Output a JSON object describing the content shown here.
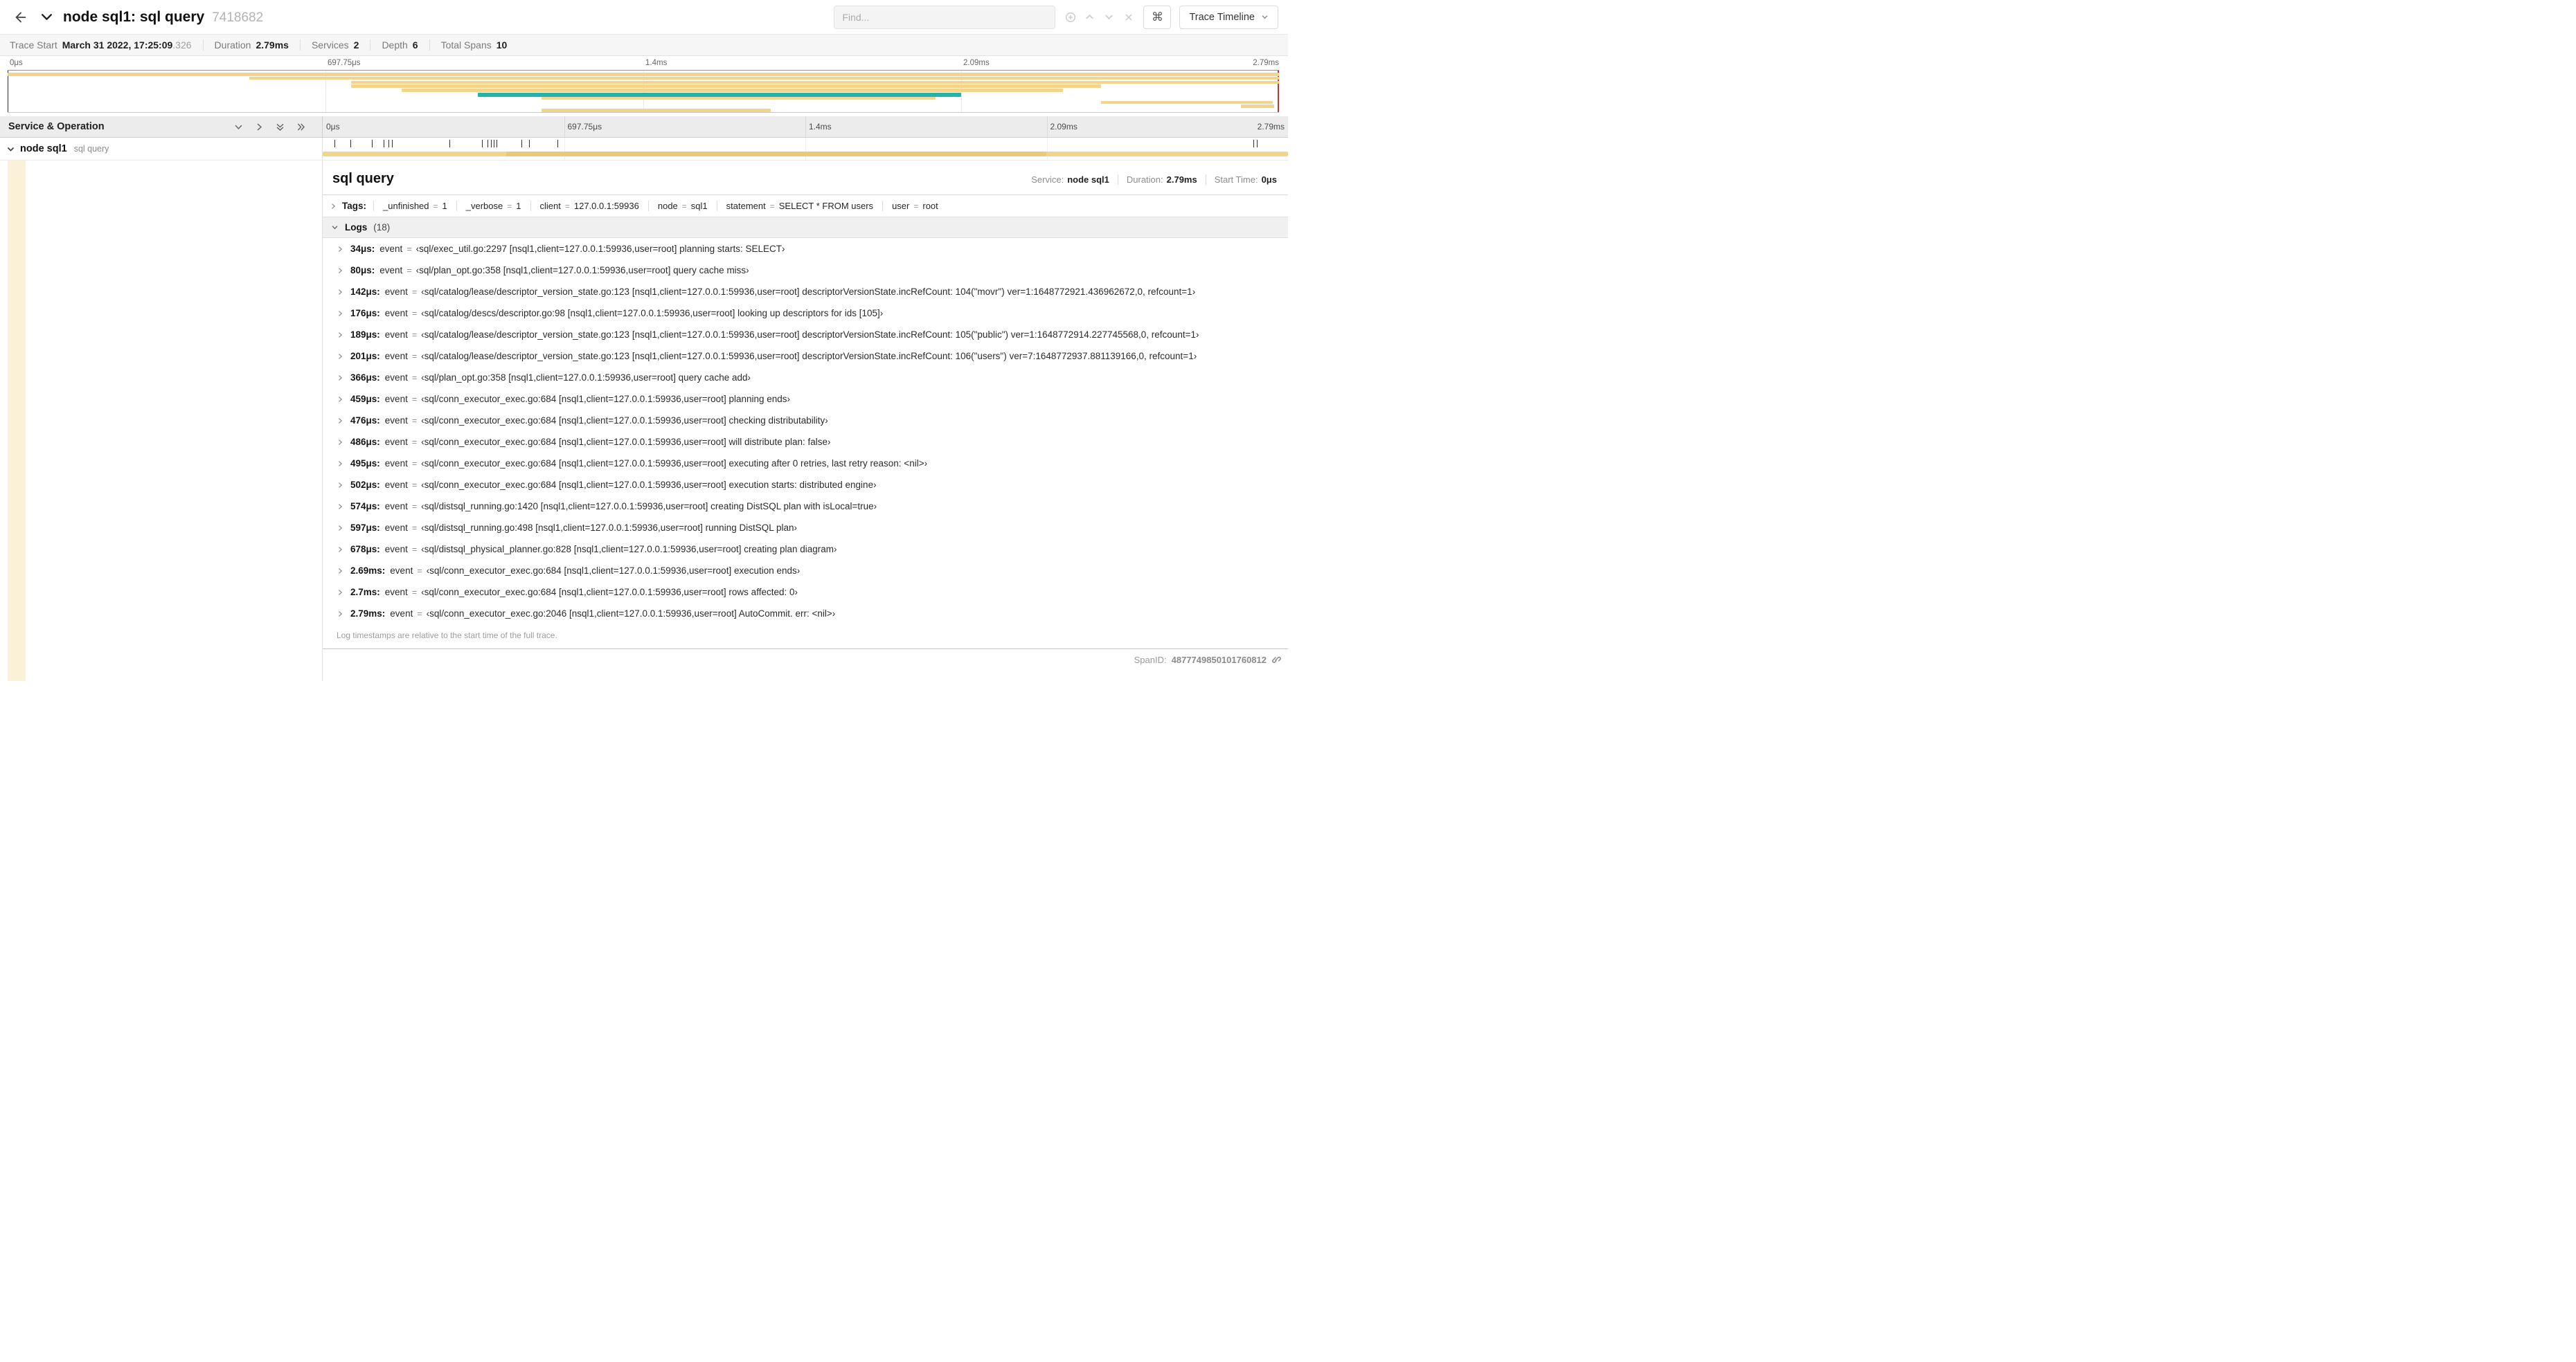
{
  "colors": {
    "span_tan": "#F2D48C",
    "span_tan_dark": "#ECC878",
    "span_teal": "#24B3AC",
    "row_stripe": "#FAF1D8"
  },
  "icons": {
    "back": "arrow-left",
    "collapse_trace": "chevron-down",
    "find_first": "plus-circle",
    "find_prev": "chevron-up",
    "find_next": "chevron-down",
    "find_clear": "x",
    "shortcuts": "⌘",
    "view_dropdown": "chevron-down",
    "collapse_one": "chevron-down",
    "expand_one": "chevron-right",
    "collapse_all": "double-chevron-down",
    "expand_all": "double-chevron-right",
    "link": "link"
  },
  "header": {
    "title": "node sql1: sql query",
    "trace_id": "7418682",
    "find_placeholder": "Find...",
    "view_label": "Trace Timeline"
  },
  "trace_info": {
    "items": [
      {
        "label": "Trace Start",
        "value": "March 31 2022, 17:25:09",
        "suffix": ".326"
      },
      {
        "label": "Duration",
        "value": "2.79ms"
      },
      {
        "label": "Services",
        "value": "2"
      },
      {
        "label": "Depth",
        "value": "6"
      },
      {
        "label": "Total Spans",
        "value": "10"
      }
    ]
  },
  "minimap": {
    "tick_labels": [
      "0μs",
      "697.75μs",
      "1.4ms",
      "2.09ms",
      "2.79ms"
    ],
    "spans": [
      {
        "row": 0,
        "start": 0,
        "width": 100,
        "color": "tan"
      },
      {
        "row": 1,
        "start": 19,
        "width": 81,
        "color": "tan"
      },
      {
        "row": 2,
        "start": 27,
        "width": 73,
        "color": "tan"
      },
      {
        "row": 3,
        "start": 27,
        "width": 59,
        "color": "tan"
      },
      {
        "row": 4,
        "start": 31,
        "width": 52,
        "color": "tan"
      },
      {
        "row": 5,
        "start": 37,
        "width": 38,
        "color": "teal"
      },
      {
        "row": 6,
        "start": 42,
        "width": 31,
        "color": "tan"
      },
      {
        "row": 7,
        "start": 86,
        "width": 13.5,
        "color": "tan"
      },
      {
        "row": 8,
        "start": 97,
        "width": 2.6,
        "color": "tan"
      },
      {
        "row": 9,
        "start": 42,
        "width": 18,
        "color": "tan"
      }
    ]
  },
  "timeline": {
    "left_title": "Service & Operation",
    "tick_labels": [
      "0μs",
      "697.75μs",
      "1.4ms",
      "2.09ms",
      "2.79ms"
    ]
  },
  "span_row": {
    "service": "node sql1",
    "operation": "sql query",
    "tick_pcts": [
      1.2,
      2.9,
      5.1,
      6.3,
      6.8,
      7.2,
      13.1,
      16.5,
      17.1,
      17.4,
      17.7,
      18,
      20.6,
      21.4,
      24.3,
      96.4,
      96.8
    ],
    "bar_dark_segments": [
      {
        "start": 19,
        "width": 56
      }
    ]
  },
  "detail": {
    "title": "sql query",
    "meta": [
      {
        "label": "Service:",
        "value": "node sql1"
      },
      {
        "label": "Duration:",
        "value": "2.79ms"
      },
      {
        "label": "Start Time:",
        "value": "0μs"
      }
    ],
    "tags_label": "Tags:",
    "tag_eq": "=",
    "tags": [
      {
        "key": "_unfinished",
        "value": "1"
      },
      {
        "key": "_verbose",
        "value": "1"
      },
      {
        "key": "client",
        "value": "127.0.0.1:59936"
      },
      {
        "key": "node",
        "value": "sql1"
      },
      {
        "key": "statement",
        "value": "SELECT * FROM users"
      },
      {
        "key": "user",
        "value": "root"
      }
    ],
    "logs_label": "Logs",
    "logs_count": "(18)",
    "log_event_key": "event",
    "log_eq": "=",
    "logs": [
      {
        "time": "34μs:",
        "msg": "‹sql/exec_util.go:2297 [nsql1,client=127.0.0.1:59936,user=root] planning starts: SELECT›"
      },
      {
        "time": "80μs:",
        "msg": "‹sql/plan_opt.go:358 [nsql1,client=127.0.0.1:59936,user=root] query cache miss›"
      },
      {
        "time": "142μs:",
        "msg": "‹sql/catalog/lease/descriptor_version_state.go:123 [nsql1,client=127.0.0.1:59936,user=root] descriptorVersionState.incRefCount: 104(\"movr\") ver=1:1648772921.436962672,0, refcount=1›"
      },
      {
        "time": "176μs:",
        "msg": "‹sql/catalog/descs/descriptor.go:98 [nsql1,client=127.0.0.1:59936,user=root] looking up descriptors for ids [105]›"
      },
      {
        "time": "189μs:",
        "msg": "‹sql/catalog/lease/descriptor_version_state.go:123 [nsql1,client=127.0.0.1:59936,user=root] descriptorVersionState.incRefCount: 105(\"public\") ver=1:1648772914.227745568,0, refcount=1›"
      },
      {
        "time": "201μs:",
        "msg": "‹sql/catalog/lease/descriptor_version_state.go:123 [nsql1,client=127.0.0.1:59936,user=root] descriptorVersionState.incRefCount: 106(\"users\") ver=7:1648772937.881139166,0, refcount=1›"
      },
      {
        "time": "366μs:",
        "msg": "‹sql/plan_opt.go:358 [nsql1,client=127.0.0.1:59936,user=root] query cache add›"
      },
      {
        "time": "459μs:",
        "msg": "‹sql/conn_executor_exec.go:684 [nsql1,client=127.0.0.1:59936,user=root] planning ends›"
      },
      {
        "time": "476μs:",
        "msg": "‹sql/conn_executor_exec.go:684 [nsql1,client=127.0.0.1:59936,user=root] checking distributability›"
      },
      {
        "time": "486μs:",
        "msg": "‹sql/conn_executor_exec.go:684 [nsql1,client=127.0.0.1:59936,user=root] will distribute plan: false›"
      },
      {
        "time": "495μs:",
        "msg": "‹sql/conn_executor_exec.go:684 [nsql1,client=127.0.0.1:59936,user=root] executing after 0 retries, last retry reason: <nil>›"
      },
      {
        "time": "502μs:",
        "msg": "‹sql/conn_executor_exec.go:684 [nsql1,client=127.0.0.1:59936,user=root] execution starts: distributed engine›"
      },
      {
        "time": "574μs:",
        "msg": "‹sql/distsql_running.go:1420 [nsql1,client=127.0.0.1:59936,user=root] creating DistSQL plan with isLocal=true›"
      },
      {
        "time": "597μs:",
        "msg": "‹sql/distsql_running.go:498 [nsql1,client=127.0.0.1:59936,user=root] running DistSQL plan›"
      },
      {
        "time": "678μs:",
        "msg": "‹sql/distsql_physical_planner.go:828 [nsql1,client=127.0.0.1:59936,user=root] creating plan diagram›"
      },
      {
        "time": "2.69ms:",
        "msg": "‹sql/conn_executor_exec.go:684 [nsql1,client=127.0.0.1:59936,user=root] execution ends›"
      },
      {
        "time": "2.7ms:",
        "msg": "‹sql/conn_executor_exec.go:684 [nsql1,client=127.0.0.1:59936,user=root] rows affected: 0›"
      },
      {
        "time": "2.79ms:",
        "msg": "‹sql/conn_executor_exec.go:2046 [nsql1,client=127.0.0.1:59936,user=root] AutoCommit. err: <nil>›"
      }
    ],
    "logs_footnote": "Log timestamps are relative to the start time of the full trace.",
    "span_id_label": "SpanID:",
    "span_id": "4877749850101760812"
  }
}
